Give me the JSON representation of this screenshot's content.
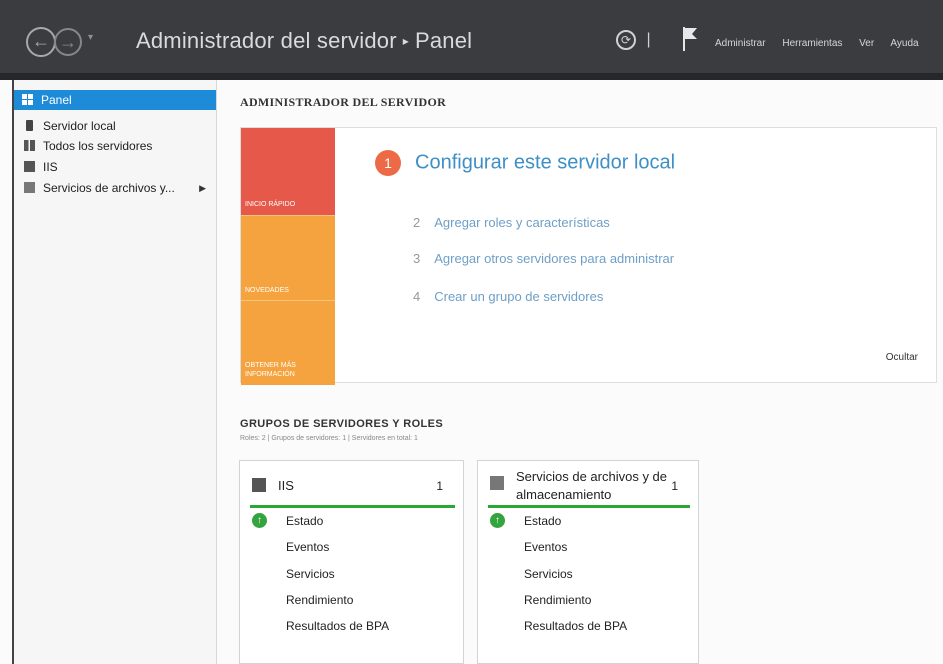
{
  "titlebar": {
    "back_glyph": "←",
    "forward_glyph": "→",
    "dropdown_glyph": "▾",
    "breadcrumb_root": "Administrador del servidor",
    "breadcrumb_sep": "▸",
    "breadcrumb_current": "Panel",
    "refresh_glyph": "⟳",
    "separator_glyph": "|",
    "menu": [
      "Administrar",
      "Herramientas",
      "Ver",
      "Ayuda"
    ]
  },
  "sidebar": {
    "items": [
      {
        "label": "Panel",
        "icon": "dashboard-icon",
        "active": true
      },
      {
        "label": "Servidor local",
        "icon": "server-icon"
      },
      {
        "label": "Todos los servidores",
        "icon": "servers-icon"
      },
      {
        "label": "IIS",
        "icon": "iis-icon"
      },
      {
        "label": "Servicios de archivos y...",
        "icon": "file-services-icon",
        "arrow": "▶"
      }
    ]
  },
  "main": {
    "title": "ADMINISTRADOR DEL SERVIDOR",
    "quick_start": {
      "tiles": [
        "INICIO RÁPIDO",
        "NOVEDADES",
        "OBTENER MÁS INFORMACIÓN"
      ],
      "step1_number": "1",
      "step1_label": "Configurar este servidor local",
      "steps": [
        {
          "number": "2",
          "label": "Agregar roles y características"
        },
        {
          "number": "3",
          "label": "Agregar otros servidores para administrar"
        },
        {
          "number": "4",
          "label": "Crear un grupo de servidores"
        }
      ],
      "hide_label": "Ocultar"
    },
    "groups": {
      "title": "GRUPOS DE SERVIDORES Y ROLES",
      "subtitle": "Roles: 2  |  Grupos de servidores: 1  |  Servidores en total: 1",
      "cards": [
        {
          "title": "IIS",
          "count": "1",
          "rows": [
            "Estado",
            "Eventos",
            "Servicios",
            "Rendimiento",
            "Resultados de BPA"
          ]
        },
        {
          "title": "Servicios de archivos y de almacenamiento",
          "count": "1",
          "rows": [
            "Estado",
            "Eventos",
            "Servicios",
            "Rendimiento",
            "Resultados de BPA"
          ]
        }
      ]
    }
  },
  "colors": {
    "accent": "#1e8bd8",
    "quick_start_red": "#e6594a",
    "quick_start_orange": "#f5a33f",
    "status_green": "#2aa735",
    "link_blue": "#3f8fc7"
  }
}
